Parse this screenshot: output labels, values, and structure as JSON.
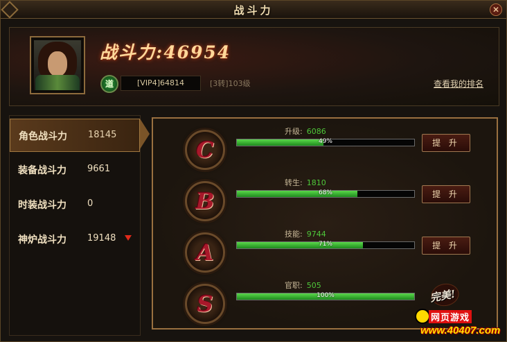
{
  "window": {
    "title": "战斗力",
    "close_label": "✕"
  },
  "header": {
    "power_label": "战斗力:46954",
    "tao_icon_label": "道",
    "vip_text": "[VIP4]64814",
    "level_text": "[3转]103级",
    "rank_link": "查看我的排名"
  },
  "menu": {
    "items": [
      {
        "label": "角色战斗力",
        "value": "18145"
      },
      {
        "label": "装备战斗力",
        "value": "9661"
      },
      {
        "label": "时装战斗力",
        "value": "0"
      },
      {
        "label": "神炉战斗力",
        "value": "19148"
      }
    ]
  },
  "rows": [
    {
      "rank": "C",
      "stat_name": "升级:",
      "stat_value": "6086",
      "progress": 0.49,
      "progress_text": "49%",
      "button": "提 升"
    },
    {
      "rank": "B",
      "stat_name": "转生:",
      "stat_value": "1810",
      "progress": 0.68,
      "progress_text": "68%",
      "button": "提 升"
    },
    {
      "rank": "A",
      "stat_name": "技能:",
      "stat_value": "9744",
      "progress": 0.71,
      "progress_text": "71%",
      "button": "提 升"
    },
    {
      "rank": "S",
      "stat_name": "官职:",
      "stat_value": "505",
      "progress": 1.0,
      "progress_text": "100%",
      "badge": "完美!"
    }
  ],
  "watermark": {
    "line1": "网页游戏",
    "line2": "www.40407.com"
  },
  "colors": {
    "accent_green": "#4ec83a",
    "gold": "#ffd89a",
    "rank_letter": "#a8182a",
    "down_arrow": "#e02a1a"
  }
}
